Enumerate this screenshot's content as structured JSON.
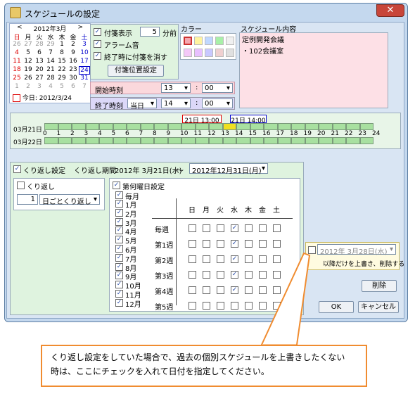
{
  "window": {
    "title": "スケジュールの設定",
    "close": "✕"
  },
  "calendar": {
    "prev": "<",
    "next": ">",
    "month_label": "2012年3月",
    "weekdays": [
      "日",
      "月",
      "火",
      "水",
      "木",
      "金",
      "土"
    ],
    "weeks": [
      [
        "26",
        "27",
        "28",
        "29",
        "1",
        "2",
        "3"
      ],
      [
        "4",
        "5",
        "6",
        "7",
        "8",
        "9",
        "10"
      ],
      [
        "11",
        "12",
        "13",
        "14",
        "15",
        "16",
        "17"
      ],
      [
        "18",
        "19",
        "20",
        "21",
        "22",
        "23",
        "24"
      ],
      [
        "25",
        "26",
        "27",
        "28",
        "29",
        "30",
        "31"
      ],
      [
        "1",
        "2",
        "3",
        "4",
        "5",
        "6",
        "7"
      ]
    ],
    "today_label": "今日: 2012/3/24"
  },
  "options": {
    "sticky_label": "付箋表示",
    "sticky_checked": true,
    "minutes_value": "5",
    "minutes_unit": "分前",
    "alarm_label": "アラーム音",
    "alarm_checked": true,
    "erase_label": "終了時に付箋を消す",
    "erase_checked": true,
    "position_button": "付箋位置設定"
  },
  "color": {
    "label": "カラー",
    "swatches": [
      "#f4a8b0",
      "#fff4a0",
      "#c0d8ff",
      "#a8f0a8",
      "#f0f0f0",
      "#f4c8f8",
      "#e8c0ff",
      "#c8c8ff",
      "#f0d0d0",
      "#e0e0e0"
    ],
    "selected": "#f4a8b0"
  },
  "schedule": {
    "label": "スケジュール内容",
    "lines": [
      "定例開発会議",
      "・102会議室"
    ]
  },
  "start": {
    "label": "開始時刻",
    "hour": "13",
    "sep": ":",
    "minute": "00"
  },
  "end": {
    "label": "終了時刻",
    "day": "当日",
    "hour": "14",
    "sep": ":",
    "minute": "00"
  },
  "timeline": {
    "row1_date": "03月21日",
    "row2_date": "03月22日",
    "start_marker": "21日 13:00",
    "end_marker": "21日 14:00",
    "hours": [
      "0",
      "1",
      "2",
      "3",
      "4",
      "5",
      "6",
      "7",
      "8",
      "9",
      "10",
      "11",
      "12",
      "13",
      "14",
      "15",
      "16",
      "17",
      "18",
      "19",
      "20",
      "21",
      "22",
      "23",
      "24"
    ]
  },
  "repeat": {
    "checkbox_label": "くり返し設定",
    "checked": true,
    "period_label": "くり返し期間",
    "period_start": "2012年 3月21日(水)",
    "tilde": "～",
    "period_end": "2012年12月31日(月)",
    "repeat_label": "くり返し",
    "repeat_checked": false,
    "interval_value": "1",
    "interval_unit": "日ごとくり返し",
    "nth_label": "第何曜日設定",
    "nth_checked": true,
    "months_all": "毎月",
    "months": [
      "1月",
      "2月",
      "3月",
      "4月",
      "5月",
      "6月",
      "7月",
      "8月",
      "9月",
      "10月",
      "11月",
      "12月"
    ],
    "weekday_headers": [
      "日",
      "月",
      "火",
      "水",
      "木",
      "金",
      "土"
    ],
    "week_rows": [
      "毎週",
      "第1週",
      "第2週",
      "第3週",
      "第4週",
      "第5週"
    ]
  },
  "override": {
    "date": "2012年 3月28日(水)",
    "desc": "以降だけを上書き、削除する",
    "checked": false
  },
  "buttons": {
    "delete": "削除",
    "ok": "OK",
    "cancel": "キャンセル"
  },
  "callout": {
    "line1": "くり返し設定をしていた場合で、過去の個別スケジュールを上書きしたくない",
    "line2": "時は、ここにチェックを入れて日付を指定してください。"
  }
}
